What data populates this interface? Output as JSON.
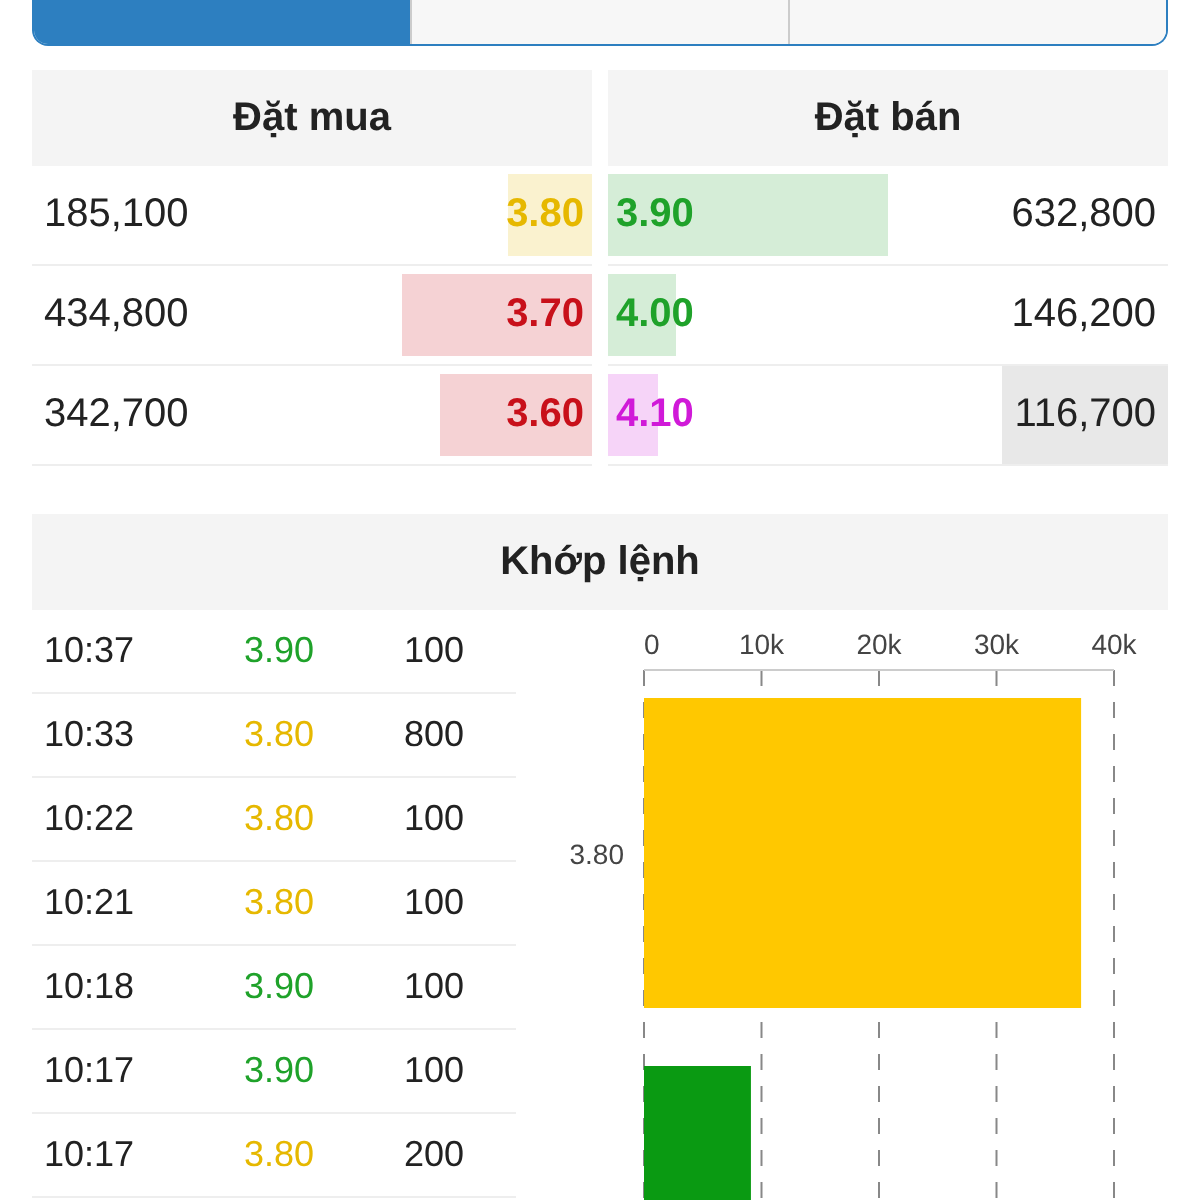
{
  "tabs": [
    {
      "selected": true
    },
    {
      "selected": false
    },
    {
      "selected": false
    }
  ],
  "order_book": {
    "buy_title": "Đặt mua",
    "sell_title": "Đặt bán",
    "rows": [
      {
        "buy": {
          "volume": "185,100",
          "price": "3.80",
          "color": "#e6b800",
          "level": 0.15
        },
        "sell": {
          "price": "3.90",
          "color": "#1fa22a",
          "level": 0.5,
          "volume": "632,800",
          "highlighted": false
        }
      },
      {
        "buy": {
          "volume": "434,800",
          "price": "3.70",
          "color": "#c8101a",
          "level": 0.34
        },
        "sell": {
          "price": "4.00",
          "color": "#1fa22a",
          "level": 0.12,
          "volume": "146,200",
          "highlighted": false
        }
      },
      {
        "buy": {
          "volume": "342,700",
          "price": "3.60",
          "color": "#c8101a",
          "level": 0.27
        },
        "sell": {
          "price": "4.10",
          "color": "#d01ad8",
          "level": 0.09,
          "volume": "116,700",
          "highlighted": true
        }
      }
    ]
  },
  "matched": {
    "title": "Khớp lệnh",
    "trades": [
      {
        "time": "10:37",
        "price": "3.90",
        "color": "#1fa22a",
        "volume": "100"
      },
      {
        "time": "10:33",
        "price": "3.80",
        "color": "#e6b800",
        "volume": "800"
      },
      {
        "time": "10:22",
        "price": "3.80",
        "color": "#e6b800",
        "volume": "100"
      },
      {
        "time": "10:21",
        "price": "3.80",
        "color": "#e6b800",
        "volume": "100"
      },
      {
        "time": "10:18",
        "price": "3.90",
        "color": "#1fa22a",
        "volume": "100"
      },
      {
        "time": "10:17",
        "price": "3.90",
        "color": "#1fa22a",
        "volume": "100"
      },
      {
        "time": "10:17",
        "price": "3.80",
        "color": "#e6b800",
        "volume": "200"
      }
    ],
    "chart_data": {
      "type": "bar",
      "orientation": "horizontal",
      "stacked": true,
      "grid": true,
      "categories": [
        "3.80",
        null
      ],
      "series": [
        {
          "color": "#ffc800",
          "values": [
            37200,
            null
          ]
        },
        {
          "color": "#0a9a12",
          "values": [
            null,
            9100
          ]
        }
      ],
      "xlim": [
        0,
        40000
      ],
      "xticks": [
        {
          "value": 0,
          "label": "0"
        },
        {
          "value": 10000,
          "label": "10k"
        },
        {
          "value": 20000,
          "label": "20k"
        },
        {
          "value": 30000,
          "label": "30k"
        },
        {
          "value": 40000,
          "label": "40k"
        }
      ]
    }
  }
}
